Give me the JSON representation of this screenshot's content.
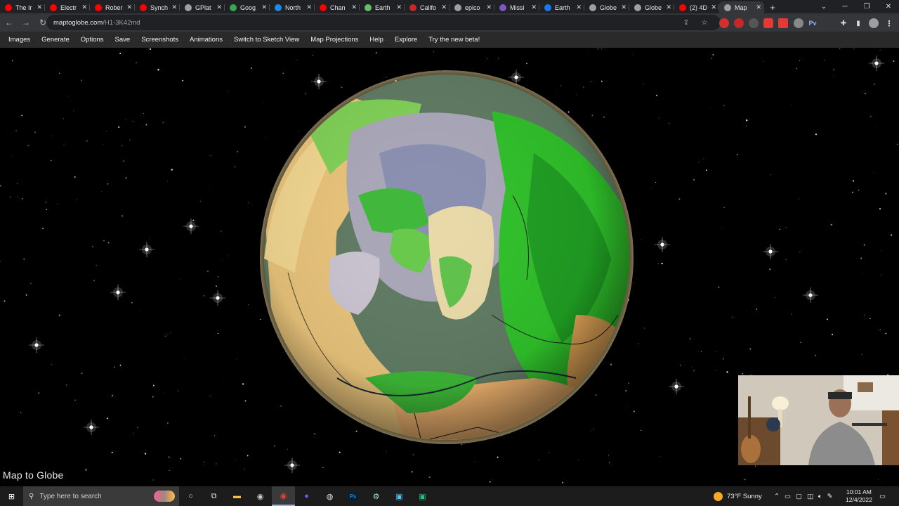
{
  "browser": {
    "tabs": [
      {
        "title": "The Ir",
        "icon": "youtube-icon",
        "color": "#ff0000"
      },
      {
        "title": "Electr",
        "icon": "youtube-icon",
        "color": "#ff0000"
      },
      {
        "title": "Rober",
        "icon": "youtube-icon",
        "color": "#ff0000"
      },
      {
        "title": "Synch",
        "icon": "youtube-icon",
        "color": "#ff0000"
      },
      {
        "title": "GPlat",
        "icon": "globe-icon",
        "color": "#9aa0a6"
      },
      {
        "title": "Goog",
        "icon": "maps-icon",
        "color": "#34a853"
      },
      {
        "title": "North",
        "icon": "page-icon",
        "color": "#1e88e5"
      },
      {
        "title": "Chan",
        "icon": "youtube-icon",
        "color": "#ff0000"
      },
      {
        "title": "Earth",
        "icon": "cloud-icon",
        "color": "#66bb6a"
      },
      {
        "title": "Califo",
        "icon": "page-icon",
        "color": "#c62828"
      },
      {
        "title": "epico",
        "icon": "globe-icon",
        "color": "#9aa0a6"
      },
      {
        "title": "Missi",
        "icon": "page-icon",
        "color": "#7e57c2"
      },
      {
        "title": "Earth",
        "icon": "facebook-icon",
        "color": "#1877f2"
      },
      {
        "title": "Globe",
        "icon": "globe-icon",
        "color": "#9aa0a6"
      },
      {
        "title": "Globe",
        "icon": "globe-icon",
        "color": "#9aa0a6"
      },
      {
        "title": "(2) 4D",
        "icon": "youtube-icon",
        "color": "#ff0000"
      },
      {
        "title": "Map",
        "icon": "globe-icon",
        "color": "#9aa0a6",
        "active": true
      }
    ],
    "new_tab_label": "+",
    "url_host": "maptoglobe.com",
    "url_path": "/H1-3K42md"
  },
  "menu": [
    "Images",
    "Generate",
    "Options",
    "Save",
    "Screenshots",
    "Animations",
    "Switch to Sketch View",
    "Map Projections",
    "Help",
    "Explore",
    "Try the new beta!"
  ],
  "app": {
    "label": "Map to Globe"
  },
  "taskbar": {
    "search_placeholder": "Type here to search",
    "weather": "73°F  Sunny",
    "time": "10:01 AM",
    "date": "12/4/2022"
  },
  "colors": {
    "tabbar": "#202124",
    "toolbar": "#35363a",
    "menubar": "#2a2a2a",
    "space": "#000000",
    "land_green": "#2fbf2a",
    "land_tan": "#e8c27a",
    "ice": "#8f93a8"
  }
}
